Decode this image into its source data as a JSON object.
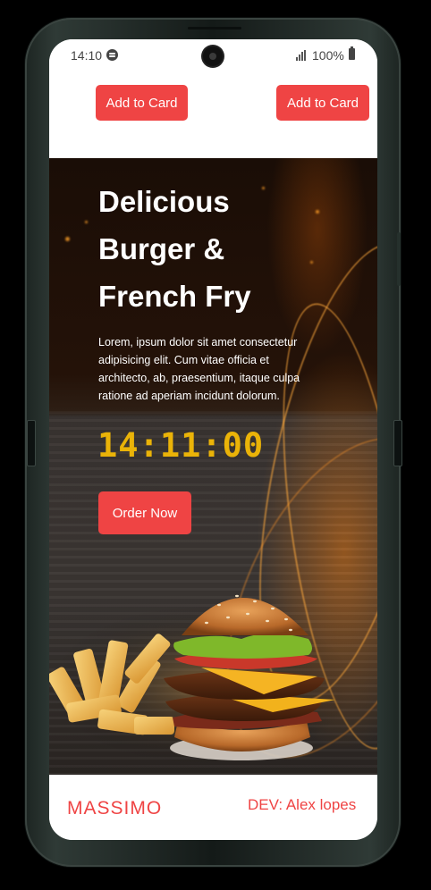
{
  "status_bar": {
    "time": "14:10",
    "battery_percent": "100%",
    "icons": [
      "spotify-icon",
      "camera-icon",
      "signal-icon",
      "battery-icon"
    ]
  },
  "cart": {
    "button_1_label": "Add to Card",
    "button_2_label": "Add to Card"
  },
  "hero": {
    "title_lines": [
      "Delicious",
      "Burger &",
      "French Fry"
    ],
    "description": "Lorem, ipsum dolor sit amet consectetur adipisicing elit. Cum vitae officia et architecto, ab, praesentium, itaque culpa ratione ad aperiam incidunt dolorum.",
    "clock": "14:11:00",
    "order_button_label": "Order Now"
  },
  "footer": {
    "brand": "MASSIMO",
    "dev": "DEV: Alex lopes"
  },
  "colors": {
    "accent": "#ef4444",
    "clock": "#eab308"
  }
}
